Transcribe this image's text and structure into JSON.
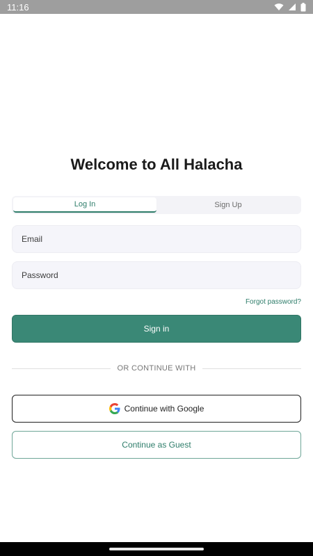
{
  "status_bar": {
    "time": "11:16",
    "icons": [
      "wifi-icon",
      "signal-icon",
      "battery-icon"
    ]
  },
  "title": "Welcome to All Halacha",
  "tabs": [
    {
      "label": "Log In",
      "active": true
    },
    {
      "label": "Sign Up",
      "active": false
    }
  ],
  "form": {
    "email_placeholder": "Email",
    "password_placeholder": "Password",
    "forgot_label": "Forgot password?",
    "sign_in_label": "Sign in"
  },
  "divider_text": "OR CONTINUE WITH",
  "google_label": "Continue with Google",
  "guest_label": "Continue as Guest",
  "colors": {
    "accent": "#2e7d6a",
    "button_bg": "#3a8876",
    "field_bg": "#f5f5fa"
  }
}
